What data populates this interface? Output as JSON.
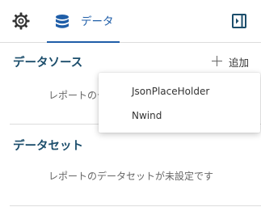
{
  "tabs": {
    "settings_icon": "gear-icon",
    "data_icon": "database-icon",
    "data_label": "データ",
    "accent_color": "#1f5ea8"
  },
  "panel_toggle_icon": "panel-toggle-icon",
  "data_sources": {
    "title": "データソース",
    "add_label": "追加",
    "empty_text": "レポートのデータソースが未設定です"
  },
  "datasets": {
    "title": "データセット",
    "empty_text": "レポートのデータセットが未設定です"
  },
  "dropdown": {
    "items": [
      {
        "label": "JsonPlaceHolder"
      },
      {
        "label": "Nwind"
      }
    ]
  }
}
